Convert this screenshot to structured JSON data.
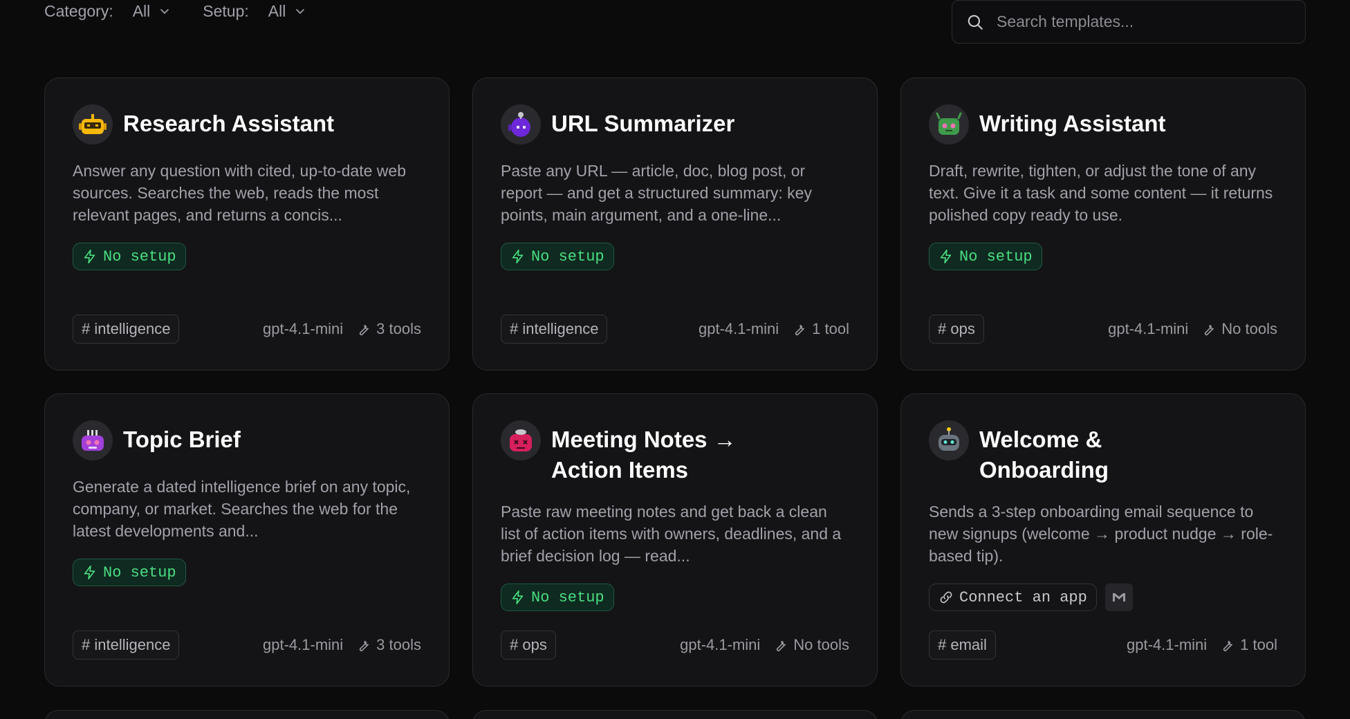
{
  "filters": {
    "category_label": "Category:",
    "category_value": "All",
    "setup_label": "Setup:",
    "setup_value": "All"
  },
  "search": {
    "placeholder": "Search templates..."
  },
  "cards": [
    {
      "title": "Research Assistant",
      "description": "Answer any question with cited, up-to-date web sources. Searches the web, reads the most relevant pages, and returns a concis...",
      "badge": "No setup",
      "tag": "# intelligence",
      "model": "gpt-4.1-mini",
      "tools": "3 tools",
      "avatar_color": "#f5b80b"
    },
    {
      "title": "URL Summarizer",
      "description": "Paste any URL — article, doc, blog post, or report — and get a structured summary: key points, main argument, and a one-line...",
      "badge": "No setup",
      "tag": "# intelligence",
      "model": "gpt-4.1-mini",
      "tools": "1 tool",
      "avatar_color": "#6d28d9"
    },
    {
      "title": "Writing Assistant",
      "description": "Draft, rewrite, tighten, or adjust the tone of any text. Give it a task and some content — it returns polished copy ready to use.",
      "badge": "No setup",
      "tag": "# ops",
      "model": "gpt-4.1-mini",
      "tools": "No tools",
      "avatar_color": "#3f9a4a"
    },
    {
      "title": "Topic Brief",
      "description": "Generate a dated intelligence brief on any topic, company, or market. Searches the web for the latest developments and...",
      "badge": "No setup",
      "tag": "# intelligence",
      "model": "gpt-4.1-mini",
      "tools": "3 tools",
      "avatar_color": "#a23fd9"
    },
    {
      "title": "Meeting Notes → Action Items",
      "description": "Paste raw meeting notes and get back a clean list of action items with owners, deadlines, and a brief decision log — read...",
      "badge": "No setup",
      "tag": "# ops",
      "model": "gpt-4.1-mini",
      "tools": "No tools",
      "avatar_color": "#d61f5c"
    },
    {
      "title": "Welcome & Onboarding",
      "description": "Sends a 3-step onboarding email sequence to new signups (welcome → product nudge → role-based tip).",
      "connect": "Connect an app",
      "app_icon": "gmail-icon",
      "tag": "# email",
      "model": "gpt-4.1-mini",
      "tools": "1 tool",
      "avatar_color": "#6b7580"
    }
  ],
  "colors": {
    "background": "#0b0b0c",
    "card": "#141416",
    "badge_green": "#4ade80"
  }
}
